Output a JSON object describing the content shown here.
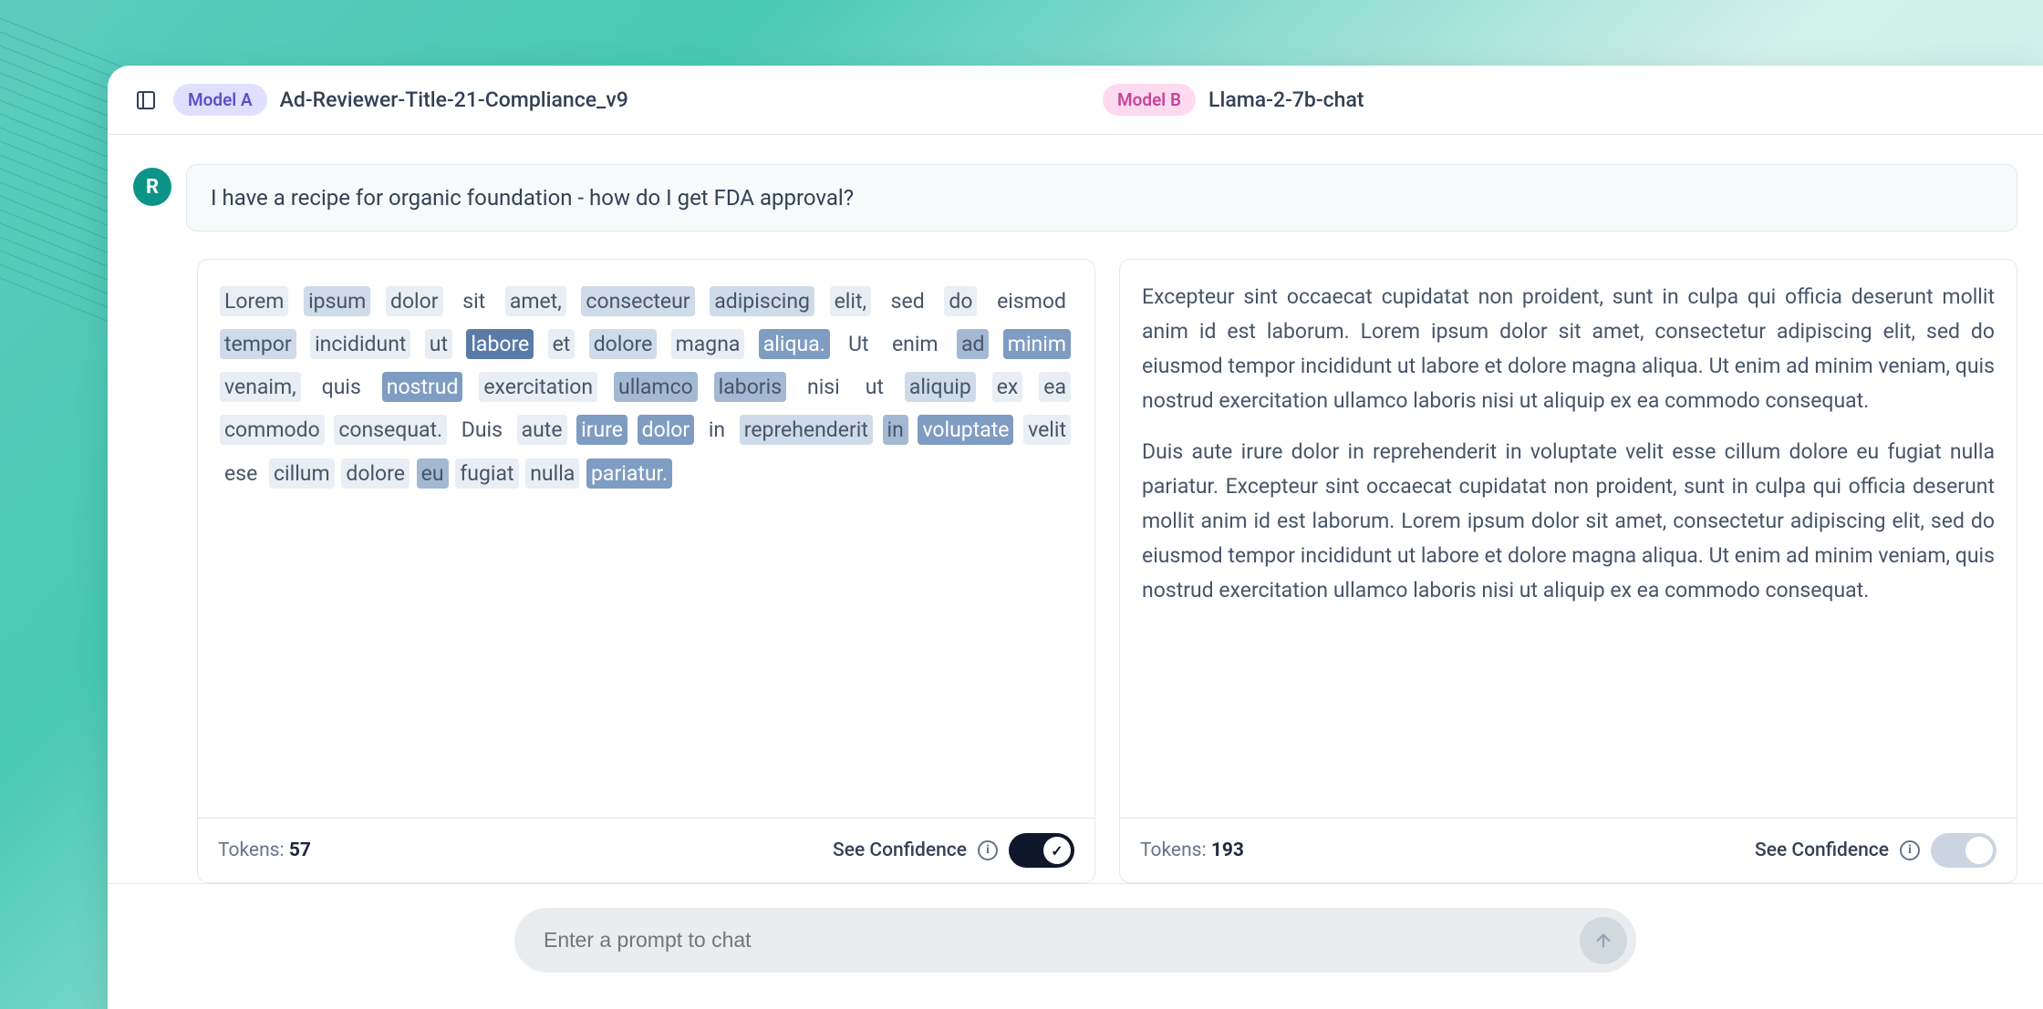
{
  "header": {
    "modelA": {
      "badge": "Model A",
      "name": "Ad-Reviewer-Title-21-Compliance_v9"
    },
    "modelB": {
      "badge": "Model B",
      "name": "Llama-2-7b-chat"
    }
  },
  "prompt": {
    "avatar_letter": "R",
    "text": "I have a recipe for organic foundation - how do I get FDA approval?"
  },
  "panelA": {
    "tokens_label": "Tokens:",
    "tokens_value": "57",
    "confidence_label": "See Confidence",
    "toggle_on": true,
    "tokens": [
      {
        "t": "Lorem",
        "c": 1
      },
      {
        "t": "ipsum",
        "c": 2
      },
      {
        "t": "dolor",
        "c": 1
      },
      {
        "t": "sit",
        "c": 0
      },
      {
        "t": "amet,",
        "c": 1
      },
      {
        "t": "consecteur",
        "c": 2
      },
      {
        "t": "adipiscing",
        "c": 2
      },
      {
        "t": "elit,",
        "c": 1
      },
      {
        "t": "sed",
        "c": 0
      },
      {
        "t": "do",
        "c": 1
      },
      {
        "t": "eismod",
        "c": 0
      },
      {
        "t": "tempor",
        "c": 2
      },
      {
        "t": "incididunt",
        "c": 1
      },
      {
        "t": "ut",
        "c": 1
      },
      {
        "t": "labore",
        "c": 5
      },
      {
        "t": "et",
        "c": 1
      },
      {
        "t": "dolore",
        "c": 2
      },
      {
        "t": "magna",
        "c": 1
      },
      {
        "t": "aliqua.",
        "c": 4
      },
      {
        "t": "Ut",
        "c": 0
      },
      {
        "t": "enim",
        "c": 0
      },
      {
        "t": "ad",
        "c": 3
      },
      {
        "t": "minim",
        "c": 4
      },
      {
        "t": "venaim,",
        "c": 1
      },
      {
        "t": "quis",
        "c": 0
      },
      {
        "t": "nostrud",
        "c": 4
      },
      {
        "t": "exercitation",
        "c": 1
      },
      {
        "t": "ullamco",
        "c": 3
      },
      {
        "t": "laboris",
        "c": 3
      },
      {
        "t": "nisi",
        "c": 0
      },
      {
        "t": "ut",
        "c": 0
      },
      {
        "t": "aliquip",
        "c": 2
      },
      {
        "t": "ex",
        "c": 1
      },
      {
        "t": "ea",
        "c": 1
      },
      {
        "t": "commodo",
        "c": 1
      },
      {
        "t": "consequat.",
        "c": 1
      },
      {
        "t": "Duis",
        "c": 0
      },
      {
        "t": "aute",
        "c": 1
      },
      {
        "t": "irure",
        "c": 4
      },
      {
        "t": "dolor",
        "c": 4
      },
      {
        "t": "in",
        "c": 0
      },
      {
        "t": "reprehenderit",
        "c": 2
      },
      {
        "t": "in",
        "c": 3
      },
      {
        "t": "voluptate",
        "c": 4
      },
      {
        "t": "velit",
        "c": 1
      },
      {
        "t": "ese",
        "c": 0
      },
      {
        "t": "cillum",
        "c": 1
      },
      {
        "t": "dolore",
        "c": 1
      },
      {
        "t": "eu",
        "c": 3
      },
      {
        "t": "fugiat",
        "c": 1
      },
      {
        "t": "nulla",
        "c": 1
      },
      {
        "t": "pariatur.",
        "c": 4
      }
    ]
  },
  "panelB": {
    "tokens_label": "Tokens:",
    "tokens_value": "193",
    "confidence_label": "See Confidence",
    "toggle_on": false,
    "paragraphs": [
      "Excepteur sint occaecat cupidatat non proident, sunt in culpa qui officia deserunt mollit anim id est laborum. Lorem ipsum dolor sit amet, consectetur adipiscing elit, sed do eiusmod tempor incididunt ut labore et dolore magna aliqua. Ut enim ad minim veniam, quis nostrud exercitation ullamco laboris nisi ut aliquip ex ea commodo consequat.",
      "Duis aute irure dolor in reprehenderit in voluptate velit esse cillum dolore eu fugiat nulla pariatur. Excepteur sint occaecat cupidatat non proident, sunt in culpa qui officia deserunt mollit anim id est laborum. Lorem ipsum dolor sit amet, consectetur adipiscing elit, sed do eiusmod tempor incididunt ut labore et dolore magna aliqua. Ut enim ad minim veniam, quis nostrud exercitation ullamco laboris nisi ut aliquip ex ea commodo consequat."
    ]
  },
  "input": {
    "placeholder": "Enter a prompt to chat"
  }
}
